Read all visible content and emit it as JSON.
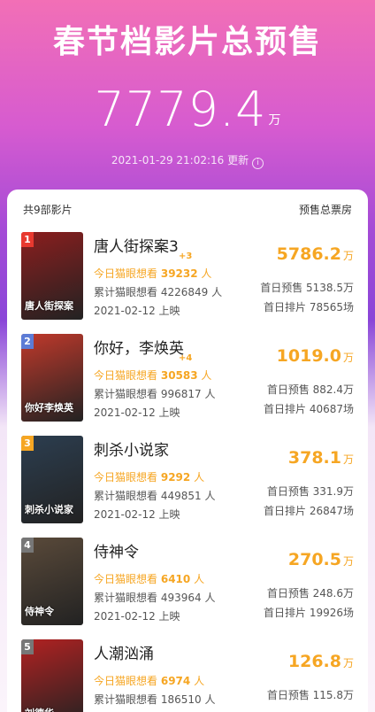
{
  "header": {
    "title": "春节档影片总预售",
    "total": "7779.4",
    "total_unit": "万",
    "updated": "2021-01-29 21:02:16 更新",
    "info_icon": "i"
  },
  "list": {
    "count_label": "共9部影片",
    "col_label": "预售总票房",
    "films": [
      {
        "rank": "1",
        "name": "唐人街探案3",
        "delta": "+3",
        "want_prefix": "今日猫眼想看",
        "want": "39232",
        "want_unit": "人",
        "cum": "累计猫眼想看 4226849 人",
        "date": "2021-02-12 上映",
        "box": "5786.2",
        "box_unit": "万",
        "first_presale": "首日预售 5138.5万",
        "first_screens": "首日排片 78565场",
        "poster_text": "唐人街探案",
        "rank_color": "#e8392f",
        "poster_color": "#8b1e1e"
      },
      {
        "rank": "2",
        "name": "你好，李焕英",
        "delta": "+4",
        "want_prefix": "今日猫眼想看",
        "want": "30583",
        "want_unit": "人",
        "cum": "累计猫眼想看 996817 人",
        "date": "2021-02-12 上映",
        "box": "1019.0",
        "box_unit": "万",
        "first_presale": "首日预售 882.4万",
        "first_screens": "首日排片 40687场",
        "poster_text": "你好李焕英",
        "rank_color": "#5c7cd6",
        "poster_color": "#c0392b"
      },
      {
        "rank": "3",
        "name": "刺杀小说家",
        "delta": "",
        "want_prefix": "今日猫眼想看",
        "want": "9292",
        "want_unit": "人",
        "cum": "累计猫眼想看 449851 人",
        "date": "2021-02-12 上映",
        "box": "378.1",
        "box_unit": "万",
        "first_presale": "首日预售 331.9万",
        "first_screens": "首日排片 26847场",
        "poster_text": "刺杀小说家",
        "rank_color": "#f6a623",
        "poster_color": "#2c3e50"
      },
      {
        "rank": "4",
        "name": "侍神令",
        "delta": "",
        "want_prefix": "今日猫眼想看",
        "want": "6410",
        "want_unit": "人",
        "cum": "累计猫眼想看 493964 人",
        "date": "2021-02-12 上映",
        "box": "270.5",
        "box_unit": "万",
        "first_presale": "首日预售 248.6万",
        "first_screens": "首日排片 19926场",
        "poster_text": "侍神令",
        "rank_color": "#777777",
        "poster_color": "#5a4a3a"
      },
      {
        "rank": "5",
        "name": "人潮汹涌",
        "delta": "",
        "want_prefix": "今日猫眼想看",
        "want": "6974",
        "want_unit": "人",
        "cum": "累计猫眼想看 186510 人",
        "date": "",
        "box": "126.8",
        "box_unit": "万",
        "first_presale": "首日预售 115.8万",
        "first_screens": "",
        "poster_text": "刘德华",
        "rank_color": "#777777",
        "poster_color": "#b22222"
      }
    ]
  }
}
